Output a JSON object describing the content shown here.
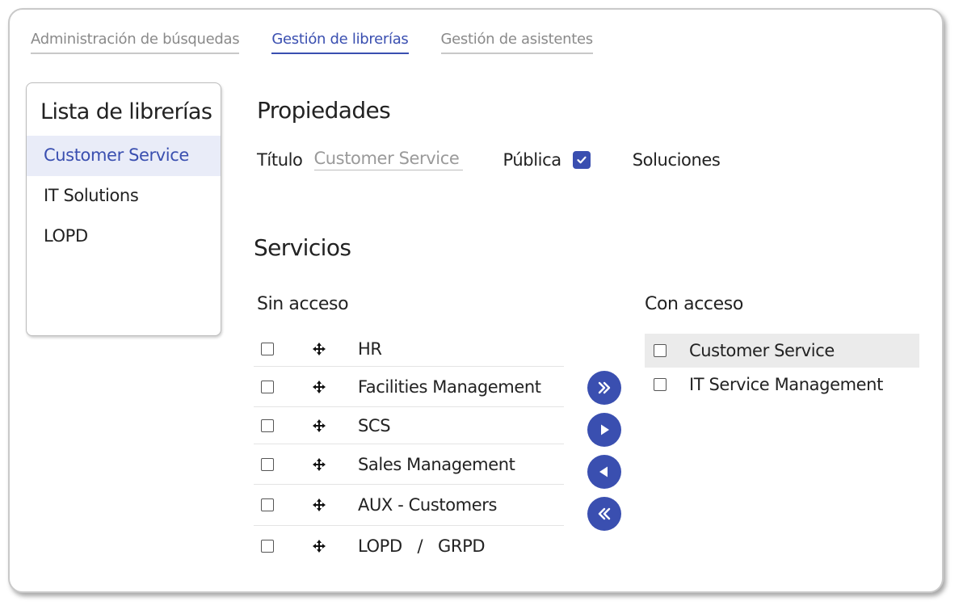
{
  "tabs": [
    {
      "label": "Administración de búsquedas",
      "active": false
    },
    {
      "label": "Gestión de librerías",
      "active": true
    },
    {
      "label": "Gestión de asistentes",
      "active": false
    }
  ],
  "library_panel": {
    "title": "Lista de librerías",
    "items": [
      {
        "label": "Customer Service",
        "selected": true
      },
      {
        "label": "IT Solutions",
        "selected": false
      },
      {
        "label": "LOPD",
        "selected": false
      }
    ]
  },
  "properties": {
    "heading": "Propiedades",
    "title_label": "Título",
    "title_value": "Customer Service",
    "public_label": "Pública",
    "public_checked": true,
    "solutions_label": "Soluciones"
  },
  "services": {
    "heading": "Servicios",
    "without_access": {
      "title": "Sin acceso",
      "items": [
        "HR",
        "Facilities Management",
        "SCS",
        "Sales Management",
        "AUX - Customers",
        "LOPD   /   GRPD"
      ]
    },
    "with_access": {
      "title": "Con acceso",
      "items": [
        "Customer Service",
        "IT Service Management"
      ]
    },
    "transfer_buttons": [
      "move-all-right",
      "move-right",
      "move-left",
      "move-all-left"
    ]
  },
  "colors": {
    "accent": "#3a4fb0",
    "selected_bg": "#e9ecf8",
    "highlight_row": "#ebebeb"
  }
}
